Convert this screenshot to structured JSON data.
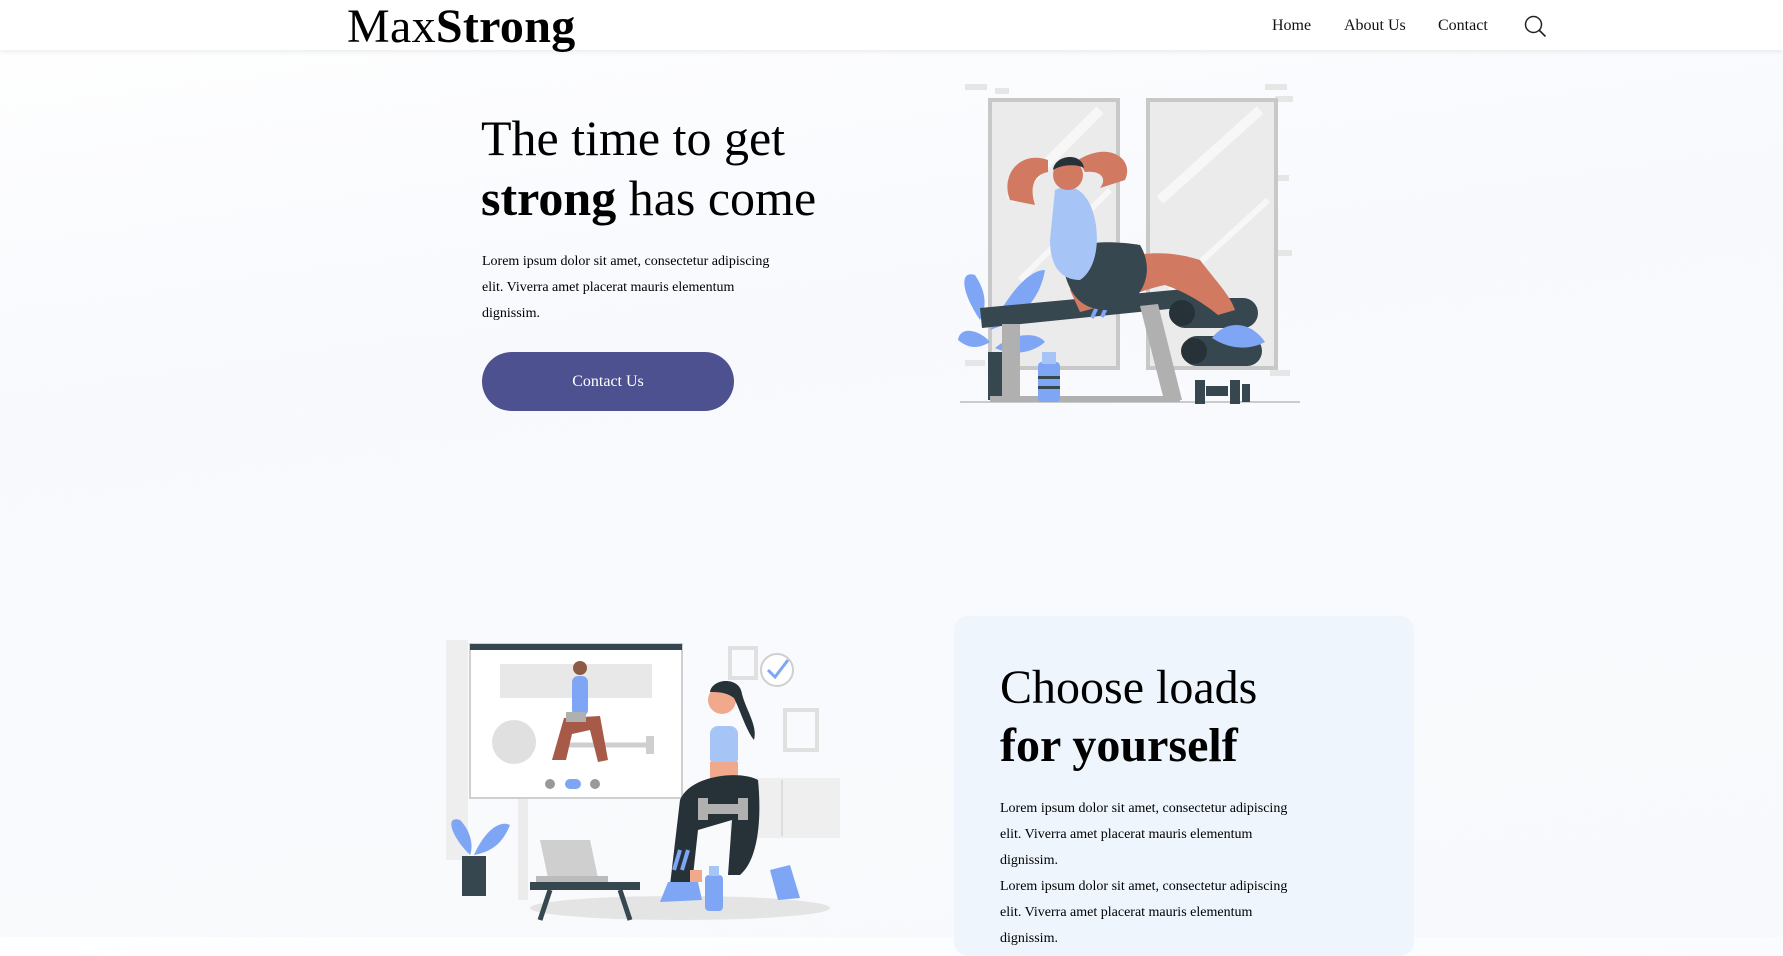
{
  "header": {
    "logo_light": "Max",
    "logo_bold": "Strong",
    "nav": {
      "home": "Home",
      "about": "About Us",
      "contact": "Contact"
    },
    "search_icon": "search-icon"
  },
  "hero": {
    "title_line1": "The time to get",
    "title_bold": "strong",
    "title_rest": "has come",
    "paragraph_lines": [
      "Lorem ipsum dolor sit amet, consectetur adipiscing",
      "elit. Viverra amet placerat mauris elementum",
      "dignissim."
    ],
    "cta_label": "Contact Us",
    "illustration": "man-doing-situps-illustration"
  },
  "feature": {
    "title_line1": "Choose loads",
    "title_bold": "for yourself",
    "paragraph_lines": [
      "Lorem ipsum dolor sit amet, consectetur adipiscing",
      "elit. Viverra amet placerat mauris elementum",
      "dignissim.",
      "Lorem ipsum dolor sit amet, consectetur adipiscing",
      "elit. Viverra amet placerat mauris elementum",
      "dignissim."
    ],
    "illustration": "woman-online-workout-illustration"
  },
  "colors": {
    "accent": "#4e518f",
    "card_bg": "#eef5fd",
    "illustration_blue": "#7ea6f5",
    "illustration_skin": "#d17a61",
    "illustration_dark": "#37474f"
  }
}
